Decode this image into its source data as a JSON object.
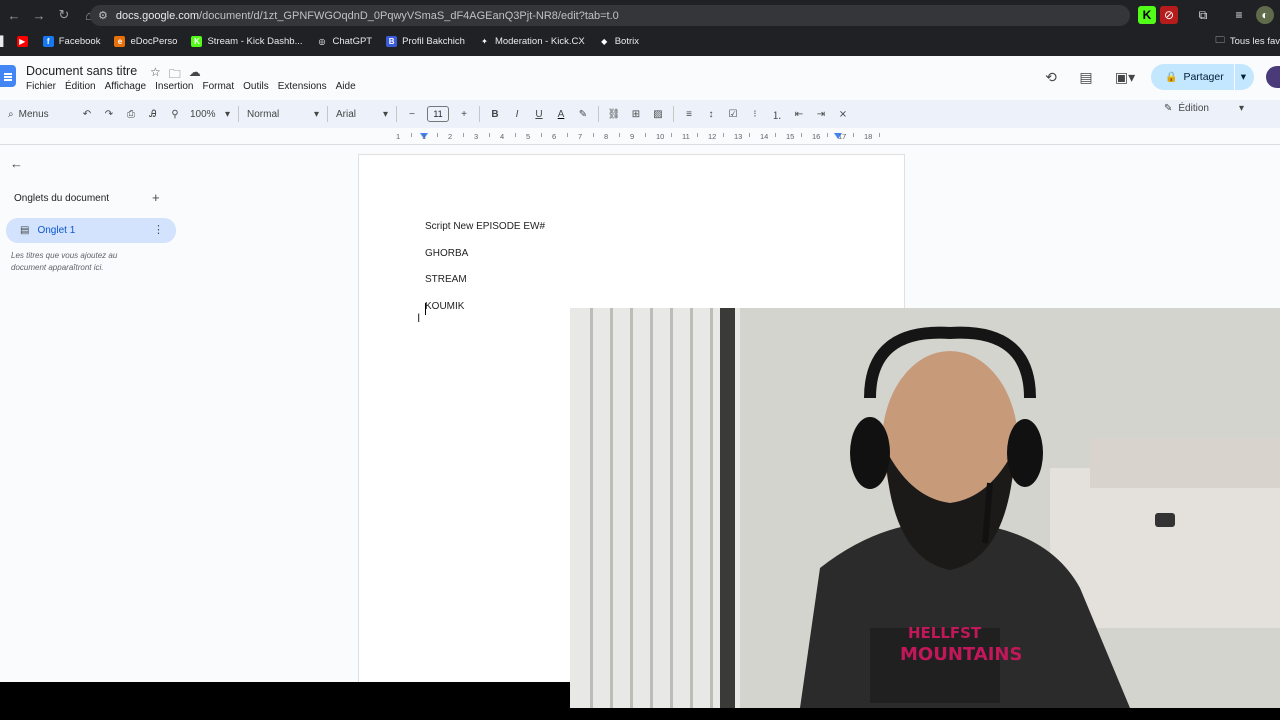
{
  "browser": {
    "url_host": "docs.google.com",
    "url_path": "/document/d/1zt_GPNFWGOqdnD_0PqwyVSmaS_dF4AGEanQ3Pjt-NR8/edit?tab=t.0",
    "bookmarks": [
      {
        "label": "Facebook",
        "color": "#1877f2",
        "glyph": "f"
      },
      {
        "label": "eDocPerso",
        "color": "#e8710a",
        "glyph": "e"
      },
      {
        "label": "Stream - Kick Dashb...",
        "color": "#53fc18",
        "glyph": "K"
      },
      {
        "label": "ChatGPT",
        "color": "#202124",
        "glyph": "◎"
      },
      {
        "label": "Profil Bakchich",
        "color": "#3b5bdb",
        "glyph": "B"
      },
      {
        "label": "Moderation - Kick.CX",
        "color": "#202124",
        "glyph": "✦"
      },
      {
        "label": "Botrix",
        "color": "#202124",
        "glyph": "◆"
      }
    ],
    "bookmarks_right": "Tous les fav"
  },
  "docs": {
    "title": "Document sans titre",
    "menu": [
      "Fichier",
      "Édition",
      "Affichage",
      "Insertion",
      "Format",
      "Outils",
      "Extensions",
      "Aide"
    ],
    "share_label": "Partager",
    "toolbar": {
      "menus_label": "Menus",
      "zoom": "100%",
      "style": "Normal",
      "font": "Arial",
      "font_size": "11",
      "mode": "Édition"
    },
    "ruler_ticks": [
      "1",
      "1",
      "2",
      "3",
      "4",
      "5",
      "6",
      "7",
      "8",
      "9",
      "10",
      "11",
      "12",
      "13",
      "14",
      "15",
      "16",
      "17",
      "18"
    ],
    "sidebar": {
      "heading": "Onglets du document",
      "tab_label": "Onglet 1",
      "hint": "Les titres que vous ajoutez au document apparaîtront ici."
    },
    "body_lines": [
      "Script New EPISODE EW#",
      "GHORBA",
      "STREAM",
      "KOUMIK"
    ]
  },
  "colors": {
    "docs_blue": "#4285f4",
    "share_bg": "#c2e7ff",
    "tab_selected_bg": "#d3e3fd",
    "toolbar_bg": "#edf2fa"
  }
}
